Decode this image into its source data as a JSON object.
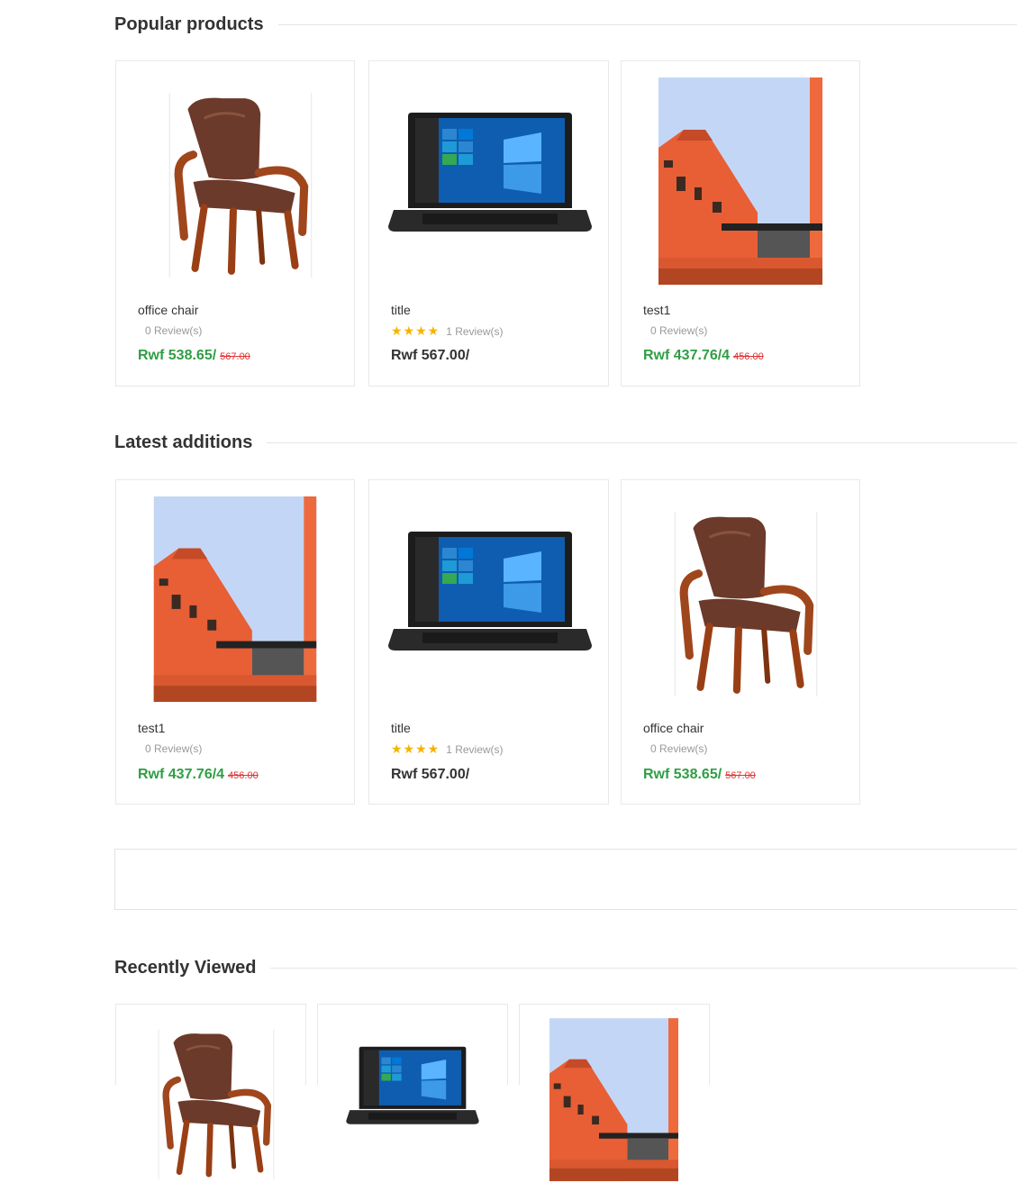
{
  "sections": {
    "popular": {
      "title": "Popular products"
    },
    "latest": {
      "title": "Latest additions"
    },
    "recent": {
      "title": "Recently Viewed"
    }
  },
  "popular_products": [
    {
      "name": "office chair",
      "reviews": "0 Review(s)",
      "price": "Rwf 538.65/",
      "old_price": "567.00",
      "image": "chair-photo"
    },
    {
      "name": "title",
      "reviews": "1 Review(s)",
      "stars": "★★★★",
      "price": "Rwf 567.00/",
      "image": "laptop-photo"
    },
    {
      "name": "test1",
      "reviews": "0 Review(s)",
      "price": "Rwf 437.76/4",
      "old_price": "456.00",
      "image": "building-photo"
    }
  ],
  "latest_additions": [
    {
      "name": "test1",
      "reviews": "0 Review(s)",
      "price": "Rwf 437.76/4",
      "old_price": "456.00",
      "image": "building-photo"
    },
    {
      "name": "title",
      "reviews": "1 Review(s)",
      "stars": "★★★★",
      "price": "Rwf 567.00/",
      "image": "laptop-photo"
    },
    {
      "name": "office chair",
      "reviews": "0 Review(s)",
      "price": "Rwf 538.65/",
      "old_price": "567.00",
      "image": "chair-photo"
    }
  ],
  "recently_viewed": [
    {
      "image": "chair-photo"
    },
    {
      "image": "laptop-photo"
    },
    {
      "image": "building-photo"
    }
  ],
  "colors": {
    "sale_price": "#2f9e44",
    "old_price": "#e03131",
    "star": "#f5b301"
  }
}
